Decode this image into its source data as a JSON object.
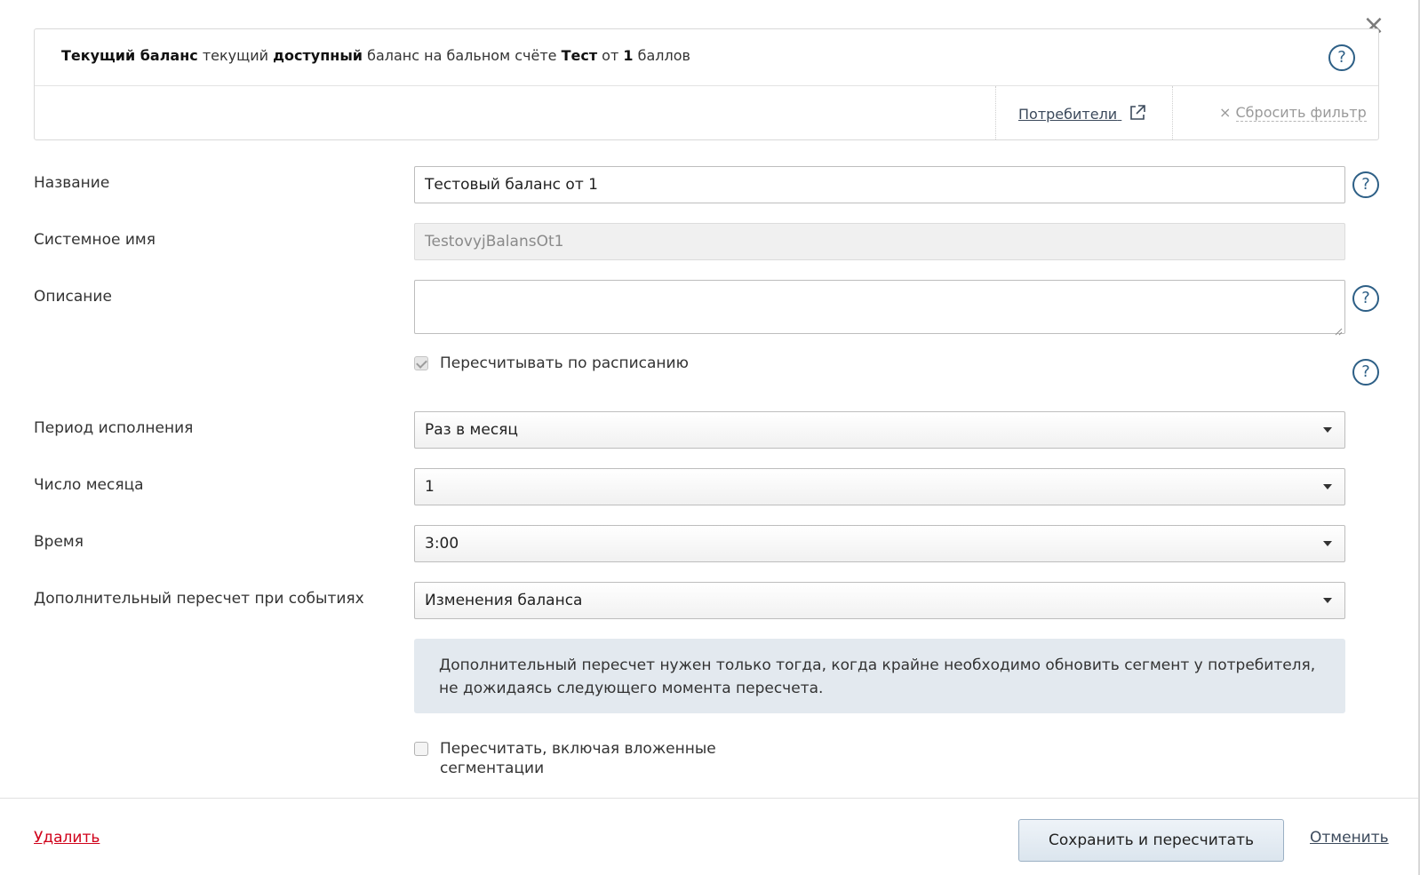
{
  "dialog": {
    "close_label": "×"
  },
  "filter": {
    "parts": [
      {
        "text": "Текущий баланс",
        "bold": true
      },
      {
        "text": " текущий ",
        "bold": false
      },
      {
        "text": "доступный",
        "bold": true
      },
      {
        "text": " баланс на бальном счёте ",
        "bold": false
      },
      {
        "text": "Тест",
        "bold": true
      },
      {
        "text": " от ",
        "bold": false
      },
      {
        "text": "1",
        "bold": true
      },
      {
        "text": " баллов",
        "bold": false
      }
    ],
    "consumers_link": "Потребители",
    "reset_prefix": "×",
    "reset_label": "Сбросить фильтр"
  },
  "form": {
    "name_label": "Название",
    "name_value": "Тестовый баланс от 1",
    "system_name_label": "Системное имя",
    "system_name_value": "TestovyjBalansOt1",
    "description_label": "Описание",
    "description_value": "",
    "recalc_schedule_label": "Пересчитывать по расписанию",
    "recalc_schedule_checked": true,
    "period_label": "Период исполнения",
    "period_value": "Раз в месяц",
    "day_label": "Число месяца",
    "day_value": "1",
    "time_label": "Время",
    "time_value": "3:00",
    "extra_recalc_label": "Дополнительный пересчет при событиях",
    "extra_recalc_value": "Изменения баланса",
    "info_text": "Дополнительный пересчет нужен только тогда, когда крайне необходимо обновить сегмент у потребителя, не дожидаясь следующего момента пересчета.",
    "nested_label": "Пересчитать, включая вложенные сегментации",
    "nested_checked": false
  },
  "footer": {
    "delete_label": "Удалить",
    "save_label": "Сохранить и пересчитать",
    "cancel_label": "Отменить"
  },
  "colors": {
    "delete": "#d0021b",
    "help_icon": "#2d5f86",
    "info_bg": "#e3e9ef"
  },
  "icons": {
    "help": "?",
    "external": "external-link-icon",
    "caret": "chevron-down-icon"
  }
}
